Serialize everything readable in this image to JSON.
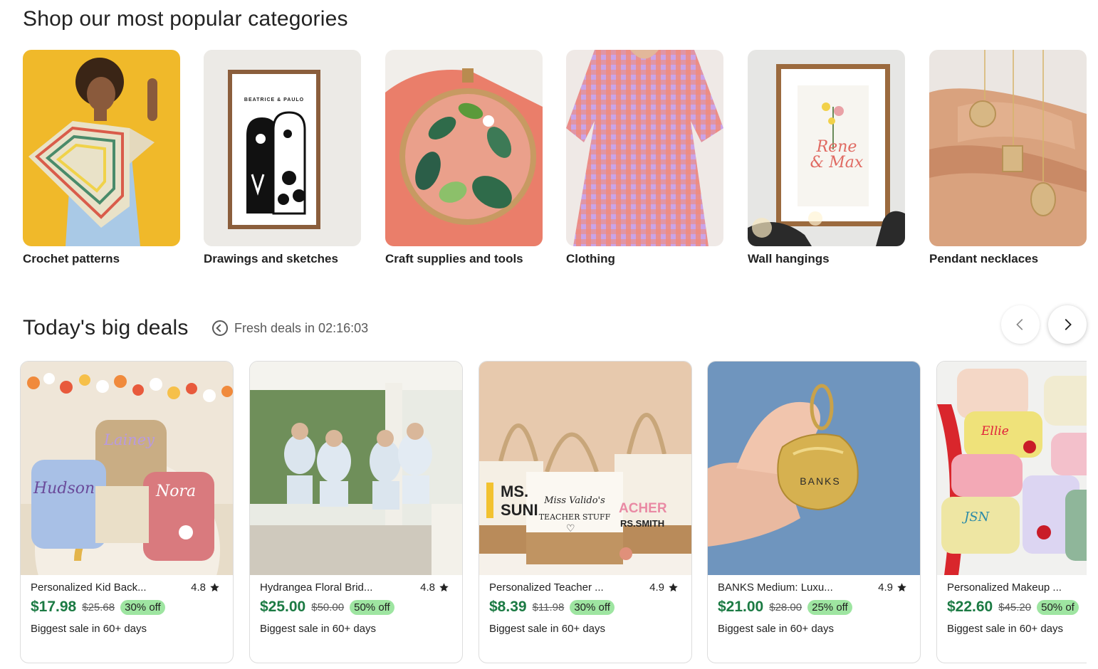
{
  "categories": {
    "title": "Shop our most popular categories",
    "items": [
      {
        "label": "Crochet patterns"
      },
      {
        "label": "Drawings and sketches"
      },
      {
        "label": "Craft supplies and tools"
      },
      {
        "label": "Clothing"
      },
      {
        "label": "Wall hangings"
      },
      {
        "label": "Pendant necklaces"
      }
    ]
  },
  "deals": {
    "title": "Today's big deals",
    "fresh_text": "Fresh deals in 02:16:03",
    "prev_icon": "chevron-left-icon",
    "next_icon": "chevron-right-icon",
    "items": [
      {
        "name": "Personalized Kid Back...",
        "rating": "4.8",
        "price": "$17.98",
        "original": "$25.68",
        "discount": "30% off",
        "note": "Biggest sale in 60+ days"
      },
      {
        "name": "Hydrangea Floral Brid...",
        "rating": "4.8",
        "price": "$25.00",
        "original": "$50.00",
        "discount": "50% off",
        "note": "Biggest sale in 60+ days"
      },
      {
        "name": "Personalized Teacher ...",
        "rating": "4.9",
        "price": "$8.39",
        "original": "$11.98",
        "discount": "30% off",
        "note": "Biggest sale in 60+ days"
      },
      {
        "name": "BANKS Medium: Luxu...",
        "rating": "4.9",
        "price": "$21.00",
        "original": "$28.00",
        "discount": "25% off",
        "note": "Biggest sale in 60+ days"
      },
      {
        "name": "Personalized Makeup ...",
        "rating": "",
        "price": "$22.60",
        "original": "$45.20",
        "discount": "50% of",
        "note": "Biggest sale in 60+ days"
      }
    ]
  },
  "images": {
    "print_text": "BEATRICE & PAULO",
    "frame_text_1": "Rene",
    "frame_text_2": "& Max",
    "backpack_1": "Hudson",
    "backpack_2": "Lainey",
    "backpack_3": "Nora",
    "tote_1_a": "MS.",
    "tote_1_b": "SUNI",
    "tote_2_a": "Miss Valido's",
    "tote_2_b": "TEACHER STUFF",
    "tote_3_a": "ACHER",
    "tote_3_b": "RS.SMITH",
    "keychain": "BANKS",
    "pouch_1": "Ellie",
    "pouch_2": "JSN"
  },
  "colors": {
    "price_green": "#1b7a43",
    "badge_green": "#9ee5a1"
  }
}
